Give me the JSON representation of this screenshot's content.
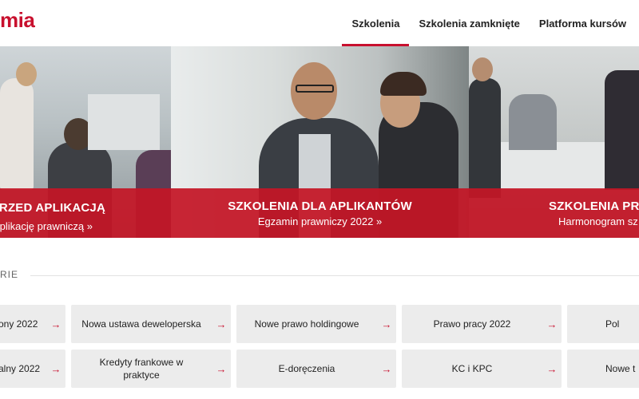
{
  "header": {
    "logo_text": "mia",
    "nav": [
      {
        "label": "Szkolenia",
        "active": true
      },
      {
        "label": "Szkolenia zamknięte",
        "active": false
      },
      {
        "label": "Platforma kursów",
        "active": false
      }
    ]
  },
  "banner": {
    "panels": [
      {
        "title": "A PRZED APLIKACJĄ",
        "subtitle": "plikację prawniczą »"
      },
      {
        "title": "SZKOLENIA DLA APLIKANTÓW",
        "subtitle": "Egzamin prawniczy 2022 »"
      },
      {
        "title": "SZKOLENIA PRA",
        "subtitle": "Harmonogram sz"
      }
    ]
  },
  "section": {
    "label": "RIE"
  },
  "tiles": {
    "row1": [
      {
        "label": "ony 2022"
      },
      {
        "label": "Nowa ustawa deweloperska"
      },
      {
        "label": "Nowe prawo holdingowe"
      },
      {
        "label": "Prawo pracy 2022"
      },
      {
        "label": "Pol"
      }
    ],
    "row2": [
      {
        "label": "alny 2022"
      },
      {
        "label": "Kredyty frankowe w praktyce"
      },
      {
        "label": "E-doręczenia"
      },
      {
        "label": "KC i KPC"
      },
      {
        "label": "Nowe t"
      }
    ],
    "arrow_glyph": "→"
  },
  "colors": {
    "brand": "#c8102e",
    "tile_bg": "#ececec"
  }
}
